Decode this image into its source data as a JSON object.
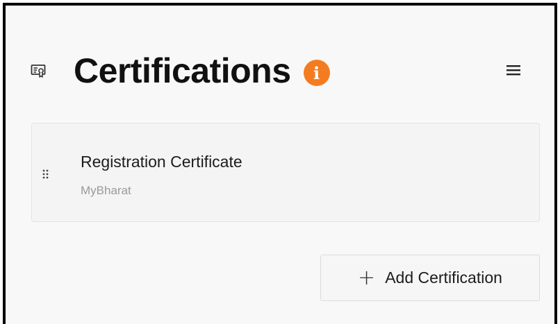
{
  "section": {
    "title": "Certifications",
    "info_icon": "info-icon",
    "section_icon": "certificate-icon",
    "menu_icon": "hamburger-menu-icon"
  },
  "certifications": [
    {
      "title": "Registration Certificate",
      "issuer": "MyBharat",
      "handle_icon": "drag-handle-icon"
    }
  ],
  "actions": {
    "add_icon": "+",
    "add_label": "Add Certification"
  },
  "colors": {
    "accent": "#f47c20",
    "background": "#f8f8f8",
    "border": "#000000"
  }
}
